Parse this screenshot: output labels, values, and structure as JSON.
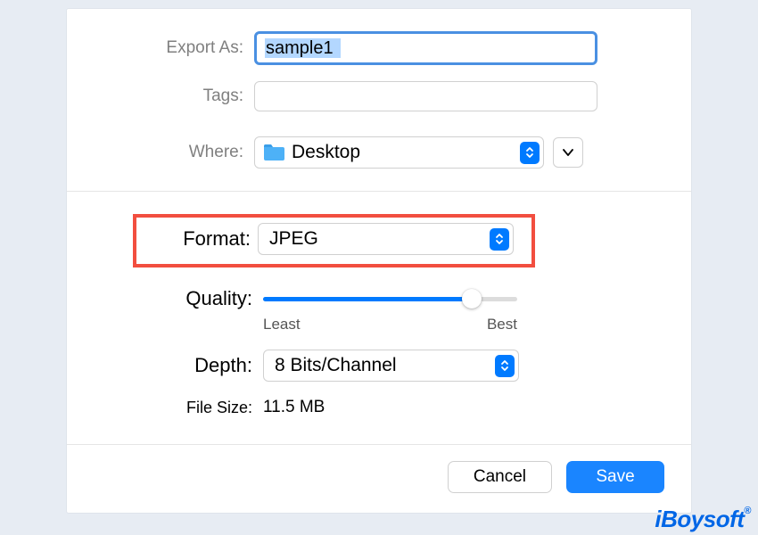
{
  "export": {
    "label": "Export As:",
    "value": "sample1"
  },
  "tags": {
    "label": "Tags:",
    "value": ""
  },
  "where": {
    "label": "Where:",
    "value": "Desktop",
    "icon": "folder-icon"
  },
  "format": {
    "label": "Format:",
    "value": "JPEG"
  },
  "quality": {
    "label": "Quality:",
    "percent": 82,
    "min_label": "Least",
    "max_label": "Best"
  },
  "depth": {
    "label": "Depth:",
    "value": "8 Bits/Channel"
  },
  "filesize": {
    "label": "File Size:",
    "value": "11.5 MB"
  },
  "buttons": {
    "cancel": "Cancel",
    "save": "Save"
  },
  "watermark": "iBoysoft"
}
